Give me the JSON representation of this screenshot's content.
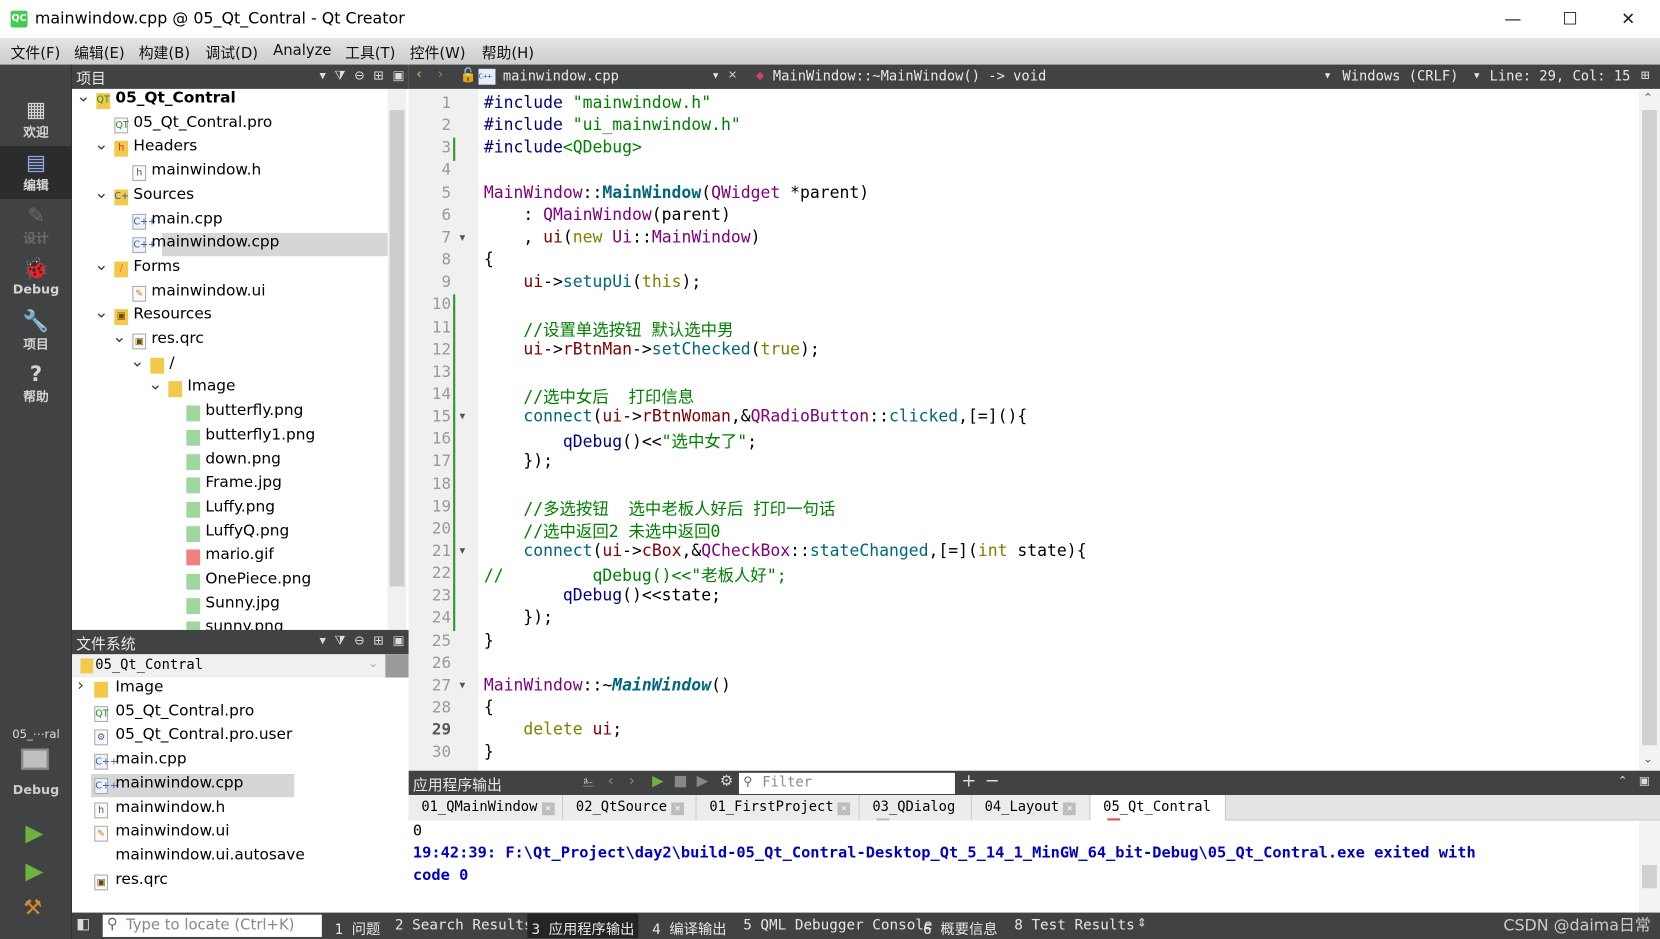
{
  "window": {
    "title": "mainwindow.cpp @ 05_Qt_Contral - Qt Creator",
    "app_icon": "QC",
    "minimize": "—",
    "maximize": "☐",
    "close": "✕"
  },
  "menu": [
    "文件(F)",
    "编辑(E)",
    "构建(B)",
    "调试(D)",
    "Analyze",
    "工具(T)",
    "控件(W)",
    "帮助(H)"
  ],
  "modes": [
    {
      "label": "欢迎",
      "icon": "grid-icon",
      "glyph": "▦"
    },
    {
      "label": "编辑",
      "icon": "edit-doc-icon",
      "glyph": "▤",
      "active": true
    },
    {
      "label": "设计",
      "icon": "pencil-icon",
      "glyph": "✎",
      "disabled": true
    },
    {
      "label": "Debug",
      "icon": "bug-icon",
      "glyph": "🐞"
    },
    {
      "label": "项目",
      "icon": "wrench-icon",
      "glyph": "🔧"
    },
    {
      "label": "帮助",
      "icon": "help-icon",
      "glyph": "?"
    }
  ],
  "kit": {
    "name": "05_⋯ral",
    "mode": "Debug"
  },
  "project_panel": {
    "title": "项目",
    "items": [
      {
        "label": "05_Qt_Contral",
        "level": 0,
        "chev": "down",
        "icon": "qt-folder",
        "bold": true
      },
      {
        "label": "05_Qt_Contral.pro",
        "level": 1,
        "icon": "pro"
      },
      {
        "label": "Headers",
        "level": 1,
        "chev": "down",
        "icon": "folder-h"
      },
      {
        "label": "mainwindow.h",
        "level": 2,
        "icon": "h"
      },
      {
        "label": "Sources",
        "level": 1,
        "chev": "down",
        "icon": "folder-cpp"
      },
      {
        "label": "main.cpp",
        "level": 2,
        "icon": "cpp"
      },
      {
        "label": "mainwindow.cpp",
        "level": 2,
        "icon": "cpp",
        "selected": true
      },
      {
        "label": "Forms",
        "level": 1,
        "chev": "down",
        "icon": "folder-ui"
      },
      {
        "label": "mainwindow.ui",
        "level": 2,
        "icon": "ui"
      },
      {
        "label": "Resources",
        "level": 1,
        "chev": "down",
        "icon": "folder-res"
      },
      {
        "label": "res.qrc",
        "level": 2,
        "chev": "down",
        "icon": "qrc"
      },
      {
        "label": "/",
        "level": 3,
        "chev": "down",
        "icon": "folder"
      },
      {
        "label": "Image",
        "level": 4,
        "chev": "down",
        "icon": "folder"
      },
      {
        "label": "butterfly.png",
        "level": 5,
        "icon": "img"
      },
      {
        "label": "butterfly1.png",
        "level": 5,
        "icon": "img"
      },
      {
        "label": "down.png",
        "level": 5,
        "icon": "img"
      },
      {
        "label": "Frame.jpg",
        "level": 5,
        "icon": "img"
      },
      {
        "label": "Luffy.png",
        "level": 5,
        "icon": "img"
      },
      {
        "label": "LuffyQ.png",
        "level": 5,
        "icon": "img"
      },
      {
        "label": "mario.gif",
        "level": 5,
        "icon": "gif"
      },
      {
        "label": "OnePiece.png",
        "level": 5,
        "icon": "img"
      },
      {
        "label": "Sunny.jpg",
        "level": 5,
        "icon": "img"
      },
      {
        "label": "sunny.png",
        "level": 5,
        "icon": "img"
      }
    ]
  },
  "fs_panel": {
    "title": "文件系统",
    "root": "05_Qt_Contral",
    "items": [
      {
        "label": "Image",
        "chev": "right",
        "icon": "folder"
      },
      {
        "label": "05_Qt_Contral.pro",
        "icon": "pro"
      },
      {
        "label": "05_Qt_Contral.pro.user",
        "icon": "user"
      },
      {
        "label": "main.cpp",
        "icon": "cpp"
      },
      {
        "label": "mainwindow.cpp",
        "icon": "cpp",
        "selected": true
      },
      {
        "label": "mainwindow.h",
        "icon": "h"
      },
      {
        "label": "mainwindow.ui",
        "icon": "ui"
      },
      {
        "label": "mainwindow.ui.autosave",
        "icon": "none"
      },
      {
        "label": "res.qrc",
        "icon": "qrc"
      }
    ]
  },
  "editor": {
    "file": "mainwindow.cpp",
    "symbol": "MainWindow::~MainWindow() -> void",
    "line_ending": "Windows (CRLF)",
    "position": "Line: 29, Col: 15",
    "current_line": 29,
    "folds": [
      7,
      15,
      21,
      27
    ],
    "changed_lines": [
      3,
      10,
      11,
      12,
      13,
      14,
      15,
      16,
      17,
      18,
      19,
      20,
      21,
      22,
      23,
      24
    ],
    "lines": [
      [
        [
          "#include ",
          "pp"
        ],
        [
          "\"mainwindow.h\"",
          "str"
        ]
      ],
      [
        [
          "#include ",
          "pp"
        ],
        [
          "\"ui_mainwindow.h\"",
          "str"
        ]
      ],
      [
        [
          "#include",
          "pp"
        ],
        [
          "<QDebug>",
          "str"
        ]
      ],
      [],
      [
        [
          "MainWindow",
          "ty"
        ],
        [
          "::",
          ""
        ],
        [
          "MainWindow",
          "fn"
        ],
        [
          "(",
          ""
        ],
        [
          "QWidget",
          "ty"
        ],
        [
          " *parent)",
          ""
        ]
      ],
      [
        [
          "    : ",
          ""
        ],
        [
          "QMainWindow",
          "ty"
        ],
        [
          "(parent)",
          ""
        ]
      ],
      [
        [
          "    , ",
          ""
        ],
        [
          "ui",
          "mem"
        ],
        [
          "(",
          ""
        ],
        [
          "new",
          "kw"
        ],
        [
          " ",
          ""
        ],
        [
          "Ui",
          "ty"
        ],
        [
          "::",
          ""
        ],
        [
          "MainWindow",
          "ty"
        ],
        [
          ")",
          ""
        ]
      ],
      [
        [
          "{",
          ""
        ]
      ],
      [
        [
          "    ",
          ""
        ],
        [
          "ui",
          "mem"
        ],
        [
          "->",
          ""
        ],
        [
          "setupUi",
          "me"
        ],
        [
          "(",
          ""
        ],
        [
          "this",
          "kw"
        ],
        [
          ");",
          ""
        ]
      ],
      [],
      [
        [
          "    //设置单选按钮 默认选中男",
          "cm"
        ]
      ],
      [
        [
          "    ",
          ""
        ],
        [
          "ui",
          "mem"
        ],
        [
          "->",
          ""
        ],
        [
          "rBtnMan",
          "mem"
        ],
        [
          "->",
          ""
        ],
        [
          "setChecked",
          "me"
        ],
        [
          "(",
          ""
        ],
        [
          "true",
          "kw"
        ],
        [
          ");",
          ""
        ]
      ],
      [],
      [
        [
          "    //选中女后  打印信息",
          "cm"
        ]
      ],
      [
        [
          "    ",
          ""
        ],
        [
          "connect",
          "me"
        ],
        [
          "(",
          ""
        ],
        [
          "ui",
          "mem"
        ],
        [
          "->",
          ""
        ],
        [
          "rBtnWoman",
          "mem"
        ],
        [
          ",&",
          ""
        ],
        [
          "QRadioButton",
          "ty"
        ],
        [
          "::",
          ""
        ],
        [
          "clicked",
          "me"
        ],
        [
          ",[=](){",
          ""
        ]
      ],
      [
        [
          "        ",
          ""
        ],
        [
          "qDebug",
          "pp"
        ],
        [
          "()<<",
          ""
        ],
        [
          "\"选中女了\"",
          "str"
        ],
        [
          ";",
          ""
        ]
      ],
      [
        [
          "    });",
          ""
        ]
      ],
      [],
      [
        [
          "    //多选按钮  选中老板人好后 打印一句话",
          "cm"
        ]
      ],
      [
        [
          "    //选中返回2 未选中返回0",
          "cm"
        ]
      ],
      [
        [
          "    ",
          ""
        ],
        [
          "connect",
          "me"
        ],
        [
          "(",
          ""
        ],
        [
          "ui",
          "mem"
        ],
        [
          "->",
          ""
        ],
        [
          "cBox",
          "mem"
        ],
        [
          ",&",
          ""
        ],
        [
          "QCheckBox",
          "ty"
        ],
        [
          "::",
          ""
        ],
        [
          "stateChanged",
          "me"
        ],
        [
          ",[=](",
          ""
        ],
        [
          "int",
          "kw"
        ],
        [
          " state){",
          ""
        ]
      ],
      [
        [
          "//         qDebug()<<\"老板人好\";",
          "cm"
        ]
      ],
      [
        [
          "        ",
          ""
        ],
        [
          "qDebug",
          "pp"
        ],
        [
          "()<<state;",
          ""
        ]
      ],
      [
        [
          "    });",
          ""
        ]
      ],
      [
        [
          "}",
          ""
        ]
      ],
      [],
      [
        [
          "MainWindow",
          "ty"
        ],
        [
          "::~",
          ""
        ],
        [
          "MainWindow",
          "it"
        ],
        [
          "()",
          ""
        ]
      ],
      [
        [
          "{",
          ""
        ]
      ],
      [
        [
          "    ",
          ""
        ],
        [
          "delete",
          "kw"
        ],
        [
          " ",
          ""
        ],
        [
          "ui",
          "mem"
        ],
        [
          ";",
          ""
        ]
      ],
      [
        [
          "}",
          ""
        ]
      ]
    ]
  },
  "output": {
    "title": "应用程序输出",
    "filter_placeholder": "Filter",
    "tabs": [
      "01_QMainWindow",
      "02_QtSource",
      "01_FirstProject",
      "03_QDialog",
      "04_Layout",
      "05_Qt_Contral"
    ],
    "active_tab": 5,
    "lines": [
      "0",
      "19:42:39: F:\\Qt_Project\\day2\\build-05_Qt_Contral-Desktop_Qt_5_14_1_MinGW_64_bit-Debug\\05_Qt_Contral.exe exited with",
      "code 0"
    ]
  },
  "statusbar": {
    "locate_placeholder": "Type to locate (Ctrl+K)",
    "panes": [
      "1 问题",
      "2 Search Results",
      "3 应用程序输出",
      "4 编译输出",
      "5 QML Debugger Console",
      "6 概要信息",
      "8 Test Results"
    ],
    "active_pane": 2
  },
  "watermark": "CSDN @daima日常"
}
